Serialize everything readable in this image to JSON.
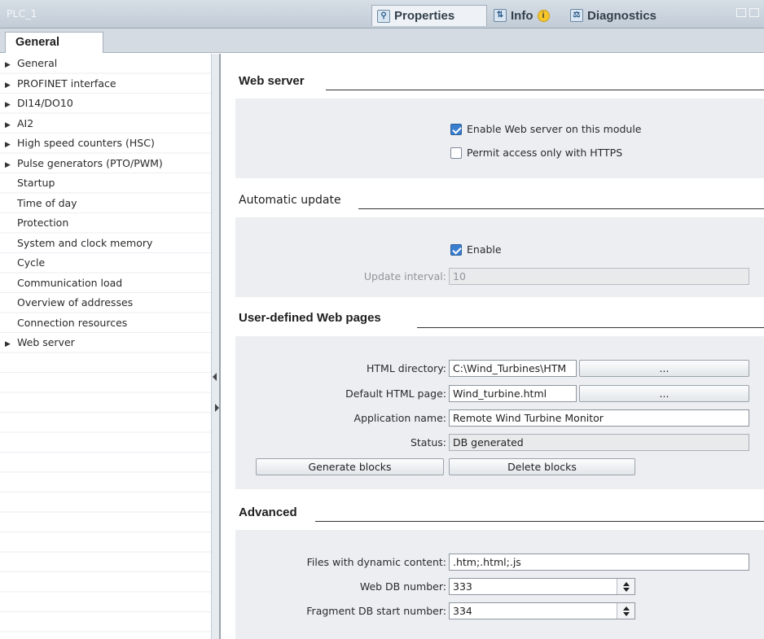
{
  "window": {
    "title": "PLC_1",
    "tabs": [
      {
        "label": "Properties",
        "icon": "properties-icon"
      },
      {
        "label": "Info",
        "icon": "info-icon"
      },
      {
        "label": "Diagnostics",
        "icon": "diagnostics-icon"
      }
    ]
  },
  "tab_strip": {
    "active_tab": "General"
  },
  "nav": {
    "items": [
      {
        "label": "General",
        "expandable": true
      },
      {
        "label": "PROFINET interface",
        "expandable": true
      },
      {
        "label": "DI14/DO10",
        "expandable": true
      },
      {
        "label": "AI2",
        "expandable": true
      },
      {
        "label": "High speed counters (HSC)",
        "expandable": true
      },
      {
        "label": "Pulse generators (PTO/PWM)",
        "expandable": true
      },
      {
        "label": "Startup",
        "expandable": false
      },
      {
        "label": "Time of day",
        "expandable": false
      },
      {
        "label": "Protection",
        "expandable": false
      },
      {
        "label": "System and clock memory",
        "expandable": false
      },
      {
        "label": "Cycle",
        "expandable": false
      },
      {
        "label": "Communication load",
        "expandable": false
      },
      {
        "label": "Overview of addresses",
        "expandable": false
      },
      {
        "label": "Connection resources",
        "expandable": false
      },
      {
        "label": "Web server",
        "expandable": true
      }
    ]
  },
  "web_server": {
    "title": "Web server",
    "enable_label": "Enable Web server on this module",
    "enable_checked": true,
    "https_label": "Permit access only with HTTPS",
    "https_checked": false
  },
  "automatic_update": {
    "title": "Automatic update",
    "enable_label": "Enable",
    "enable_checked": true,
    "interval_label": "Update interval:",
    "interval_value": "10"
  },
  "user_pages": {
    "title": "User-defined Web pages",
    "html_dir_label": "HTML directory:",
    "html_dir_value": "C:\\Wind_Turbines\\HTM",
    "default_page_label": "Default HTML page:",
    "default_page_value": "Wind_turbine.html",
    "browse_label": "...",
    "app_name_label": "Application name:",
    "app_name_value": "Remote Wind Turbine Monitor",
    "status_label": "Status:",
    "status_value": "DB generated",
    "generate_label": "Generate blocks",
    "delete_label": "Delete blocks"
  },
  "advanced": {
    "title": "Advanced",
    "dynamic_label": "Files with dynamic content:",
    "dynamic_value": ".htm;.html;.js",
    "web_db_label": "Web DB number:",
    "web_db_value": "333",
    "fragment_label": "Fragment DB start number:",
    "fragment_value": "334"
  }
}
